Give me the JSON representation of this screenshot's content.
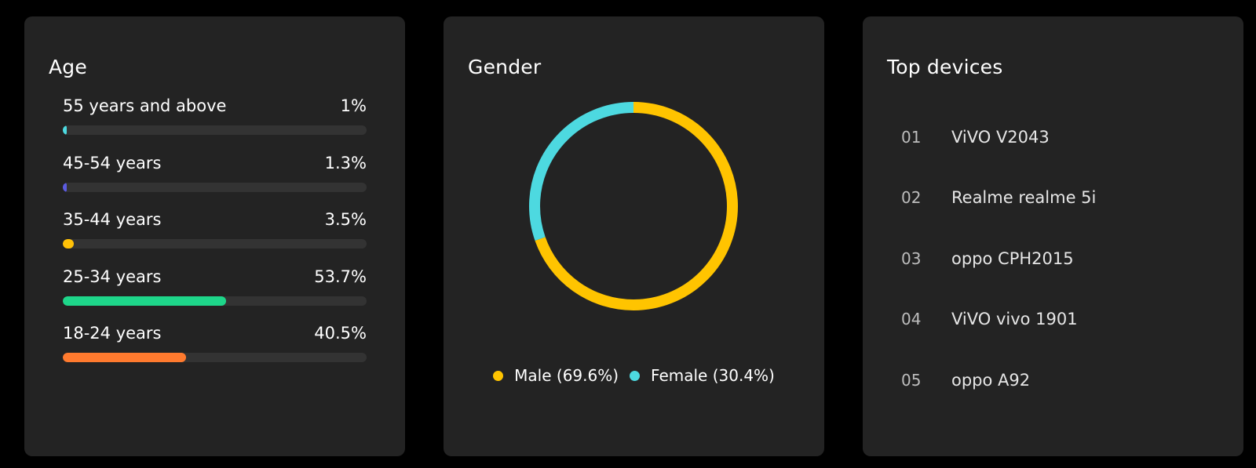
{
  "age": {
    "title": "Age",
    "rows": [
      {
        "label": "55 years and above",
        "value_text": "1%",
        "percent": 1,
        "color": "#4dd9e0"
      },
      {
        "label": "45-54 years",
        "value_text": "1.3%",
        "percent": 1.3,
        "color": "#5b5be0"
      },
      {
        "label": "35-44 years",
        "value_text": "3.5%",
        "percent": 3.5,
        "color": "#ffc107"
      },
      {
        "label": "25-34 years",
        "value_text": "53.7%",
        "percent": 53.7,
        "color": "#1ed68a"
      },
      {
        "label": "18-24 years",
        "value_text": "40.5%",
        "percent": 40.5,
        "color": "#ff7a2e"
      }
    ]
  },
  "gender": {
    "title": "Gender",
    "segments": [
      {
        "name": "Male",
        "percent": 69.6,
        "legend": "Male (69.6%)",
        "color": "#ffc400"
      },
      {
        "name": "Female",
        "percent": 30.4,
        "legend": "Female (30.4%)",
        "color": "#4dd9e0"
      }
    ]
  },
  "devices": {
    "title": "Top devices",
    "items": [
      {
        "rank": "01",
        "name": "ViVO V2043"
      },
      {
        "rank": "02",
        "name": "Realme realme 5i"
      },
      {
        "rank": "03",
        "name": "oppo CPH2015"
      },
      {
        "rank": "04",
        "name": "ViVO vivo 1901"
      },
      {
        "rank": "05",
        "name": "oppo A92"
      }
    ]
  }
}
